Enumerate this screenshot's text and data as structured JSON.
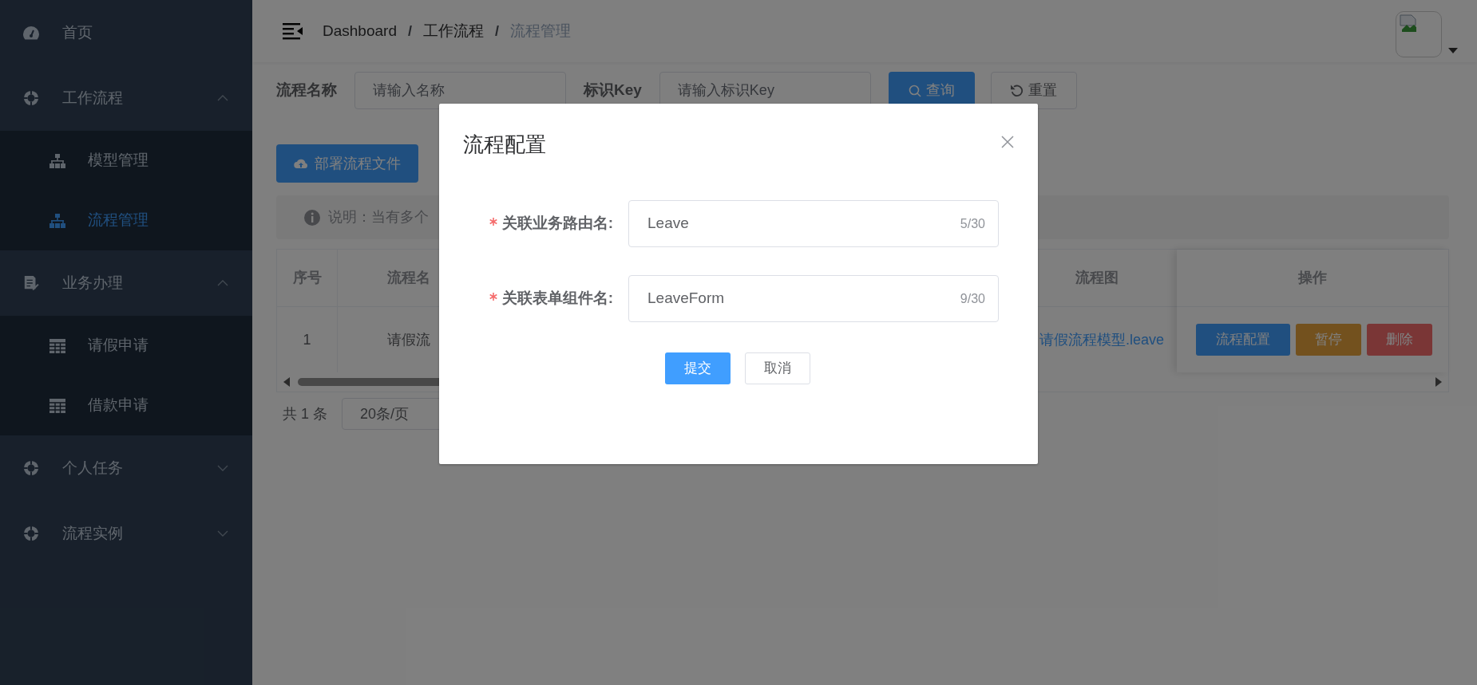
{
  "sidebar": {
    "items": [
      {
        "label": "首页",
        "selected": false
      },
      {
        "label": "工作流程",
        "selected": false,
        "expanded": true,
        "children": [
          {
            "label": "模型管理",
            "selected": false
          },
          {
            "label": "流程管理",
            "selected": true
          }
        ]
      },
      {
        "label": "业务办理",
        "selected": false,
        "expanded": true,
        "children": [
          {
            "label": "请假申请",
            "selected": false
          },
          {
            "label": "借款申请",
            "selected": false
          }
        ]
      },
      {
        "label": "个人任务",
        "selected": false,
        "expanded": false
      },
      {
        "label": "流程实例",
        "selected": false,
        "expanded": false
      }
    ]
  },
  "breadcrumb": {
    "separator": "/",
    "items": [
      "Dashboard",
      "工作流程",
      "流程管理"
    ]
  },
  "filters": [
    {
      "label": "流程名称",
      "placeholder": "请输入名称"
    },
    {
      "label": "标识Key",
      "placeholder": "请输入标识Key"
    }
  ],
  "filter_buttons": [
    {
      "label": "查询",
      "kind": "primary"
    },
    {
      "label": "重置",
      "kind": "default"
    }
  ],
  "deploy_button": "部署流程文件",
  "notice": "说明：当有多个",
  "table": {
    "columns": [
      "序号",
      "流程名",
      "流程图",
      "操作"
    ],
    "rows": [
      {
        "cells": [
          "1",
          "请假流",
          "请假流程模型.leave"
        ],
        "actions": [
          {
            "label": "流程配置",
            "kind": "primary"
          },
          {
            "label": "暂停",
            "kind": "warning"
          },
          {
            "label": "删除",
            "kind": "danger"
          }
        ]
      }
    ]
  },
  "pagination": {
    "total": "共 1 条",
    "page_size": "20条/页"
  },
  "dialog": {
    "title": "流程配置",
    "fields": [
      {
        "label": "关联业务路由名:",
        "required": true,
        "value": "Leave",
        "count": "5/30"
      },
      {
        "label": "关联表单组件名:",
        "required": true,
        "value": "LeaveForm",
        "count": "9/30"
      }
    ],
    "buttons": [
      {
        "label": "提交",
        "kind": "primary"
      },
      {
        "label": "取消",
        "kind": "default"
      }
    ]
  }
}
